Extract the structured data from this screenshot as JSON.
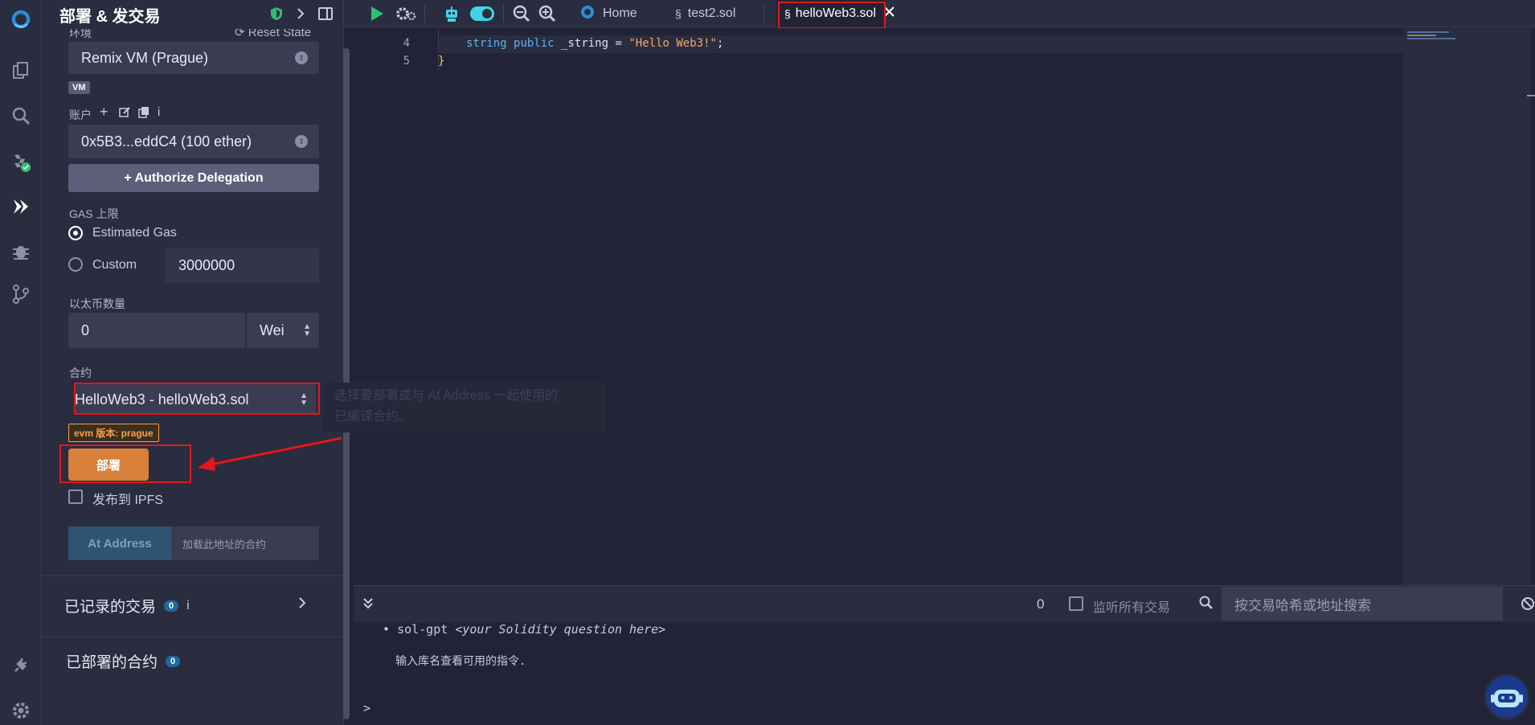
{
  "panel": {
    "title": "部署 & 发交易",
    "env_label": "环境",
    "reset_state": "Reset State",
    "environment_value": "Remix VM (Prague)",
    "vm_badge": "VM",
    "account_label": "账户",
    "account_info": "i",
    "account_value": "0x5B3...eddC4 (100 ether)",
    "authorize_label": "+ Authorize Delegation",
    "gas_label": "GAS 上限",
    "gas_estimated": "Estimated Gas",
    "gas_custom": "Custom",
    "gas_value": "3000000",
    "ether_label": "以太币数量",
    "ether_value": "0",
    "ether_unit": "Wei",
    "contract_label": "合约",
    "contract_value": "HelloWeb3 - helloWeb3.sol",
    "evm_badge": "evm 版本: prague",
    "deploy_label": "部署",
    "publish_ipfs": "发布到 IPFS",
    "at_address_label": "At Address",
    "at_address_placeholder": "加载此地址的合约",
    "recorded_tx_title": "已记录的交易",
    "recorded_tx_count": "0",
    "recorded_tx_info": "i",
    "deployed_title": "已部署的合约",
    "deployed_count": "0"
  },
  "tooltip": {
    "line1": "选择要部署或与 At Address 一起使用的",
    "line2": "已编译合约。"
  },
  "tabs": [
    {
      "label": "Home"
    },
    {
      "label": "test2.sol"
    },
    {
      "label": "helloWeb3.sol"
    }
  ],
  "editor": {
    "lines": [
      {
        "num": "4",
        "keyword": "string",
        "modifier": "public",
        "ident": "_string",
        "op": "=",
        "string": "\"Hello Web3!\"",
        "end": ";"
      },
      {
        "num": "5",
        "brace": "}"
      }
    ]
  },
  "terminal": {
    "tx_count": "0",
    "listen_all": "监听所有交易",
    "search_placeholder": "按交易哈希或地址搜索",
    "bullet_cmd": "sol-gpt",
    "bullet_arg": "<your Solidity question here>",
    "hint": "输入库名查看可用的指令.",
    "prompt": ">"
  },
  "colors": {
    "accent_green": "#2fbf71",
    "deploy_orange": "#d9803a",
    "annotation_red": "#e0181c",
    "badge_blue": "#1f6aa0"
  }
}
